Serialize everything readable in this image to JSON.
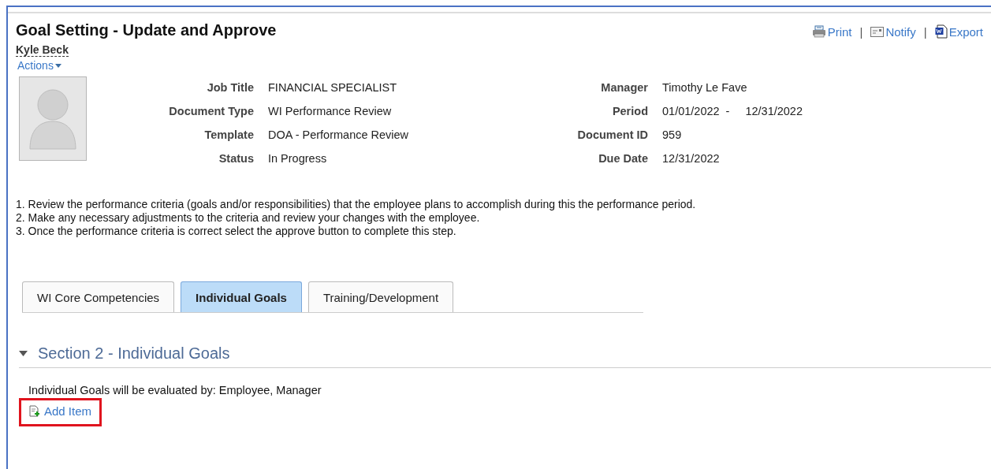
{
  "page": {
    "title": "Goal Setting - Update and Approve"
  },
  "toolbar": [
    {
      "kind": "print",
      "label": "Print"
    },
    {
      "kind": "notify",
      "label": "Notify"
    },
    {
      "kind": "export",
      "label": "Export"
    }
  ],
  "toolbar_separator": "|",
  "employee": {
    "name": "Kyle Beck",
    "actions": "Actions"
  },
  "details_left": [
    {
      "label": "Job Title",
      "value": "FINANCIAL SPECIALIST"
    },
    {
      "label": "Document Type",
      "value": "WI Performance Review"
    },
    {
      "label": "Template",
      "value": "DOA - Performance Review"
    },
    {
      "label": "Status",
      "value": "In Progress"
    }
  ],
  "details_right": [
    {
      "label": "Manager",
      "value": "Timothy Le Fave"
    },
    {
      "label": "Period",
      "value": "01/01/2022",
      "separator": "-",
      "value_end": "12/31/2022"
    },
    {
      "label": "Document ID",
      "value": "959"
    },
    {
      "label": "Due Date",
      "value": "12/31/2022"
    }
  ],
  "instructions": [
    "1. Review the performance criteria (goals and/or responsibilities) that the employee plans to accomplish during this the performance period.",
    "2. Make any necessary adjustments to the criteria and review your changes with the employee.",
    "3. Once the performance criteria is correct select the approve button to complete this step."
  ],
  "tabs": [
    {
      "label": "WI Core Competencies",
      "selected": false
    },
    {
      "label": "Individual Goals",
      "selected": true
    },
    {
      "label": "Training/Development",
      "selected": false
    }
  ],
  "section": {
    "title": "Section 2 - Individual Goals",
    "expanded": true,
    "evaluated_by": "Individual Goals will be evaluated by: Employee, Manager",
    "add_item": "Add Item",
    "add_item_highlighted": true
  }
}
